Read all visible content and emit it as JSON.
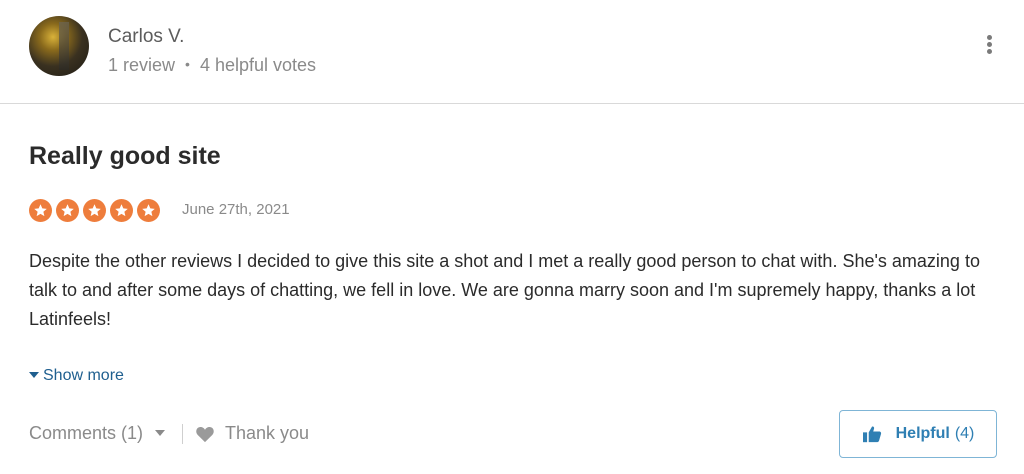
{
  "reviewer": {
    "name": "Carlos V.",
    "review_count": "1 review",
    "separator": "•",
    "helpful_votes": "4 helpful votes"
  },
  "review": {
    "title": "Really good site",
    "rating": 5,
    "date": "June 27th, 2021",
    "body": "Despite the other reviews I decided to give this site a shot and I met a really good person to chat with. She's amazing to talk to and after some days of chatting, we fell in love. We are gonna marry soon and I'm supremely happy, thanks a lot Latinfeels!",
    "show_more_label": "Show more"
  },
  "actions": {
    "comments_label": "Comments (1)",
    "thank_you_label": "Thank you",
    "helpful_label": "Helpful",
    "helpful_count": "(4)"
  },
  "icons": {
    "star": "star-icon",
    "heart": "heart-icon",
    "thumbs_up": "thumbs-up-icon",
    "more": "kebab-menu-icon"
  },
  "colors": {
    "star": "#ee7d3c",
    "link": "#1f5f8f",
    "helpful": "#2f7fb3"
  }
}
